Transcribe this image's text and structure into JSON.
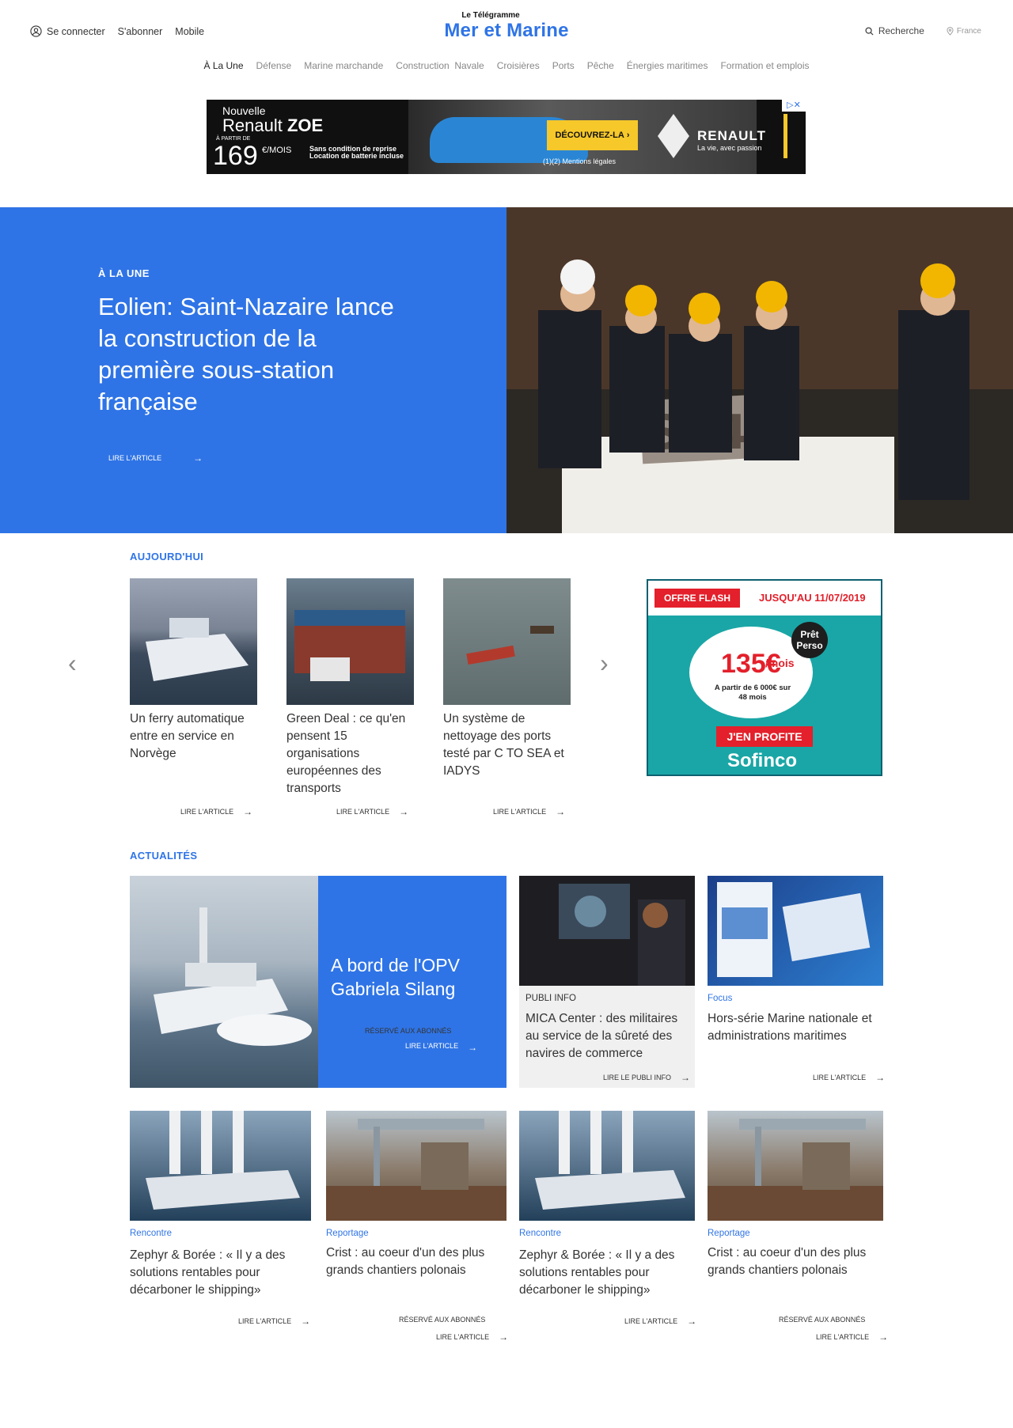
{
  "header": {
    "login": "Se connecter",
    "subscribe": "S'abonner",
    "mobile": "Mobile",
    "brand_top": "Le Télégramme",
    "brand_main": "Mer et Marine",
    "search": "Recherche",
    "region": "France",
    "brand_color": "#2f74e6",
    "accent_color": "#f6c82a"
  },
  "nav": [
    "À La Une",
    "Défense",
    "Marine marchande",
    "Construction  Navale",
    "Croisières",
    "Ports",
    "Pêche",
    "Énergies maritimes",
    "Formation et emplois"
  ],
  "ad_top": {
    "line1": "Nouvelle",
    "line2a": "Renault ",
    "line2b": "ZOE",
    "line3": "À PARTIR DE",
    "price": "169",
    "unit": "€/MOIS",
    "cond": "Sans condition de reprise Location de batterie incluse",
    "cta": "DÉCOUVREZ-LA",
    "legal": "(1)(2) Mentions légales",
    "brand": "RENAULT",
    "slogan": "La vie, avec passion"
  },
  "hero": {
    "kicker": "À LA UNE",
    "title": "Eolien: Saint-Nazaire lance la construction de la première sous-station française",
    "read": "LIRE L'ARTICLE"
  },
  "today": {
    "heading": "AUJOURD'HUI",
    "items": [
      {
        "title": "Un ferry automatique entre en service en Norvège",
        "read": "LIRE L'ARTICLE"
      },
      {
        "title": "Green Deal : ce qu'en pensent 15 organisations européennes des transports",
        "read": "LIRE L'ARTICLE"
      },
      {
        "title": "Un système de nettoyage des ports testé par C TO SEA et IADYS",
        "read": "LIRE L'ARTICLE"
      }
    ]
  },
  "ad_side": {
    "flash": "OFFRE FLASH",
    "until": "JUSQU'AU 11/07/2019",
    "badge": "Prêt Perso",
    "price": "135€",
    "per": "/mois",
    "detail": "A partir de 6 000€ sur 48 mois",
    "cta": "J'EN PROFITE",
    "brand": "Sofinco"
  },
  "news": {
    "heading": "ACTUALITÉS",
    "feature": {
      "title": "A bord de l'OPV Gabriela Silang",
      "badge": "RÉSERVÉ AUX ABONNÉS",
      "read": "LIRE L'ARTICLE"
    },
    "publi": {
      "cat": "PUBLI INFO",
      "title": "MICA Center : des militaires au service de la sûreté des navires de commerce",
      "read": "LIRE LE PUBLI INFO"
    },
    "focus": {
      "cat": "Focus",
      "title": "Hors-série Marine nationale et administrations maritimes",
      "read": "LIRE L'ARTICLE"
    },
    "row": [
      {
        "cat": "Rencontre",
        "title": "Zephyr & Borée : « Il y a des solutions rentables pour décarboner le shipping»",
        "read": "LIRE L'ARTICLE"
      },
      {
        "cat": "Reportage",
        "title": "Crist : au coeur d'un des plus grands chantiers polonais",
        "badge": "RÉSERVÉ AUX ABONNÉS",
        "read": "LIRE L'ARTICLE"
      },
      {
        "cat": "Rencontre",
        "title": "Zephyr & Borée : « Il y a des solutions rentables pour décarboner le shipping»",
        "read": "LIRE L'ARTICLE"
      },
      {
        "cat": "Reportage",
        "title": "Crist : au coeur d'un des plus grands chantiers polonais",
        "badge": "RÉSERVÉ AUX ABONNÉS",
        "read": "LIRE L'ARTICLE"
      }
    ]
  }
}
